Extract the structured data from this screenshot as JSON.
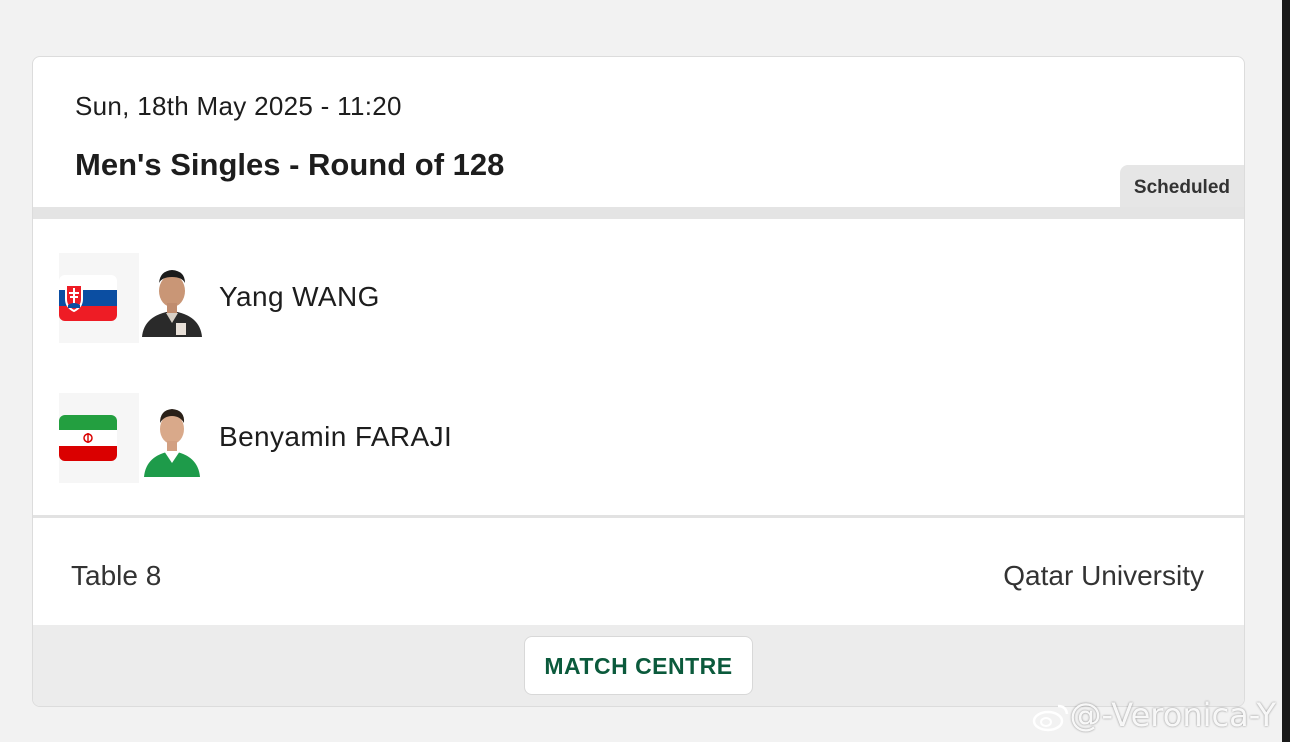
{
  "match": {
    "datetime": "Sun, 18th May 2025 - 11:20",
    "event": "Men's Singles - Round of 128",
    "status": "Scheduled"
  },
  "players": [
    {
      "name": "Yang WANG",
      "flag_icon": "slovakia-flag-icon",
      "flag_colors": [
        "#ffffff",
        "#0b4ea2",
        "#ee1c25"
      ]
    },
    {
      "name": "Benyamin FARAJI",
      "flag_icon": "iran-flag-icon",
      "flag_colors": [
        "#239f40",
        "#ffffff",
        "#da0000"
      ]
    }
  ],
  "info": {
    "table": "Table 8",
    "venue": "Qatar University"
  },
  "footer": {
    "button_label": "MATCH CENTRE"
  },
  "watermark": {
    "text": "@-Veronica-Y"
  },
  "colors": {
    "accent": "#0b5a3c",
    "divider": "#e4e4e4",
    "footer_bg": "#ececec"
  }
}
